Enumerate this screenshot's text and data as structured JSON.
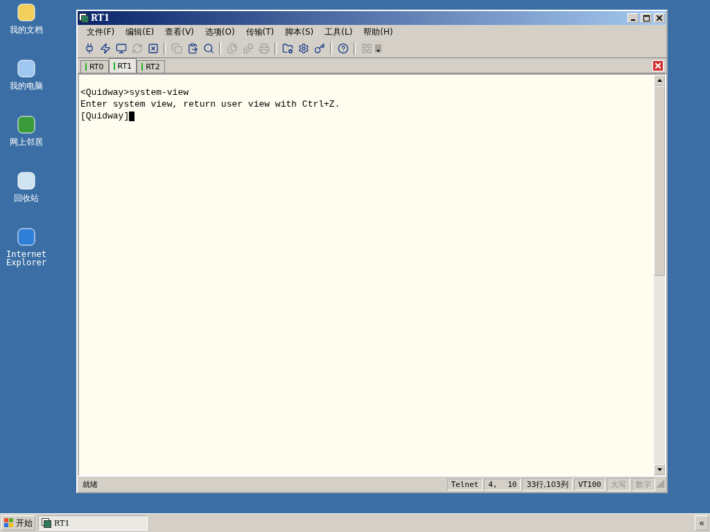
{
  "desktop_icons": [
    {
      "label": "我的文档"
    },
    {
      "label": "我的电脑"
    },
    {
      "label": "网上邻居"
    },
    {
      "label": "回收站"
    },
    {
      "label": "Internet Explorer"
    }
  ],
  "window": {
    "title": "RT1"
  },
  "menu": [
    {
      "label": "文件(F)"
    },
    {
      "label": "编辑(E)"
    },
    {
      "label": "查看(V)"
    },
    {
      "label": "选项(O)"
    },
    {
      "label": "传输(T)"
    },
    {
      "label": "脚本(S)"
    },
    {
      "label": "工具(L)"
    },
    {
      "label": "帮助(H)"
    }
  ],
  "toolbar": [
    [
      {
        "disabled": false
      },
      {
        "disabled": false
      },
      {
        "disabled": false
      },
      {
        "disabled": true
      },
      {
        "disabled": false
      }
    ],
    [
      {
        "disabled": true
      },
      {
        "disabled": false
      },
      {
        "disabled": false
      }
    ],
    [
      {
        "disabled": true
      },
      {
        "disabled": true
      },
      {
        "disabled": true
      }
    ],
    [
      {
        "disabled": false
      },
      {
        "disabled": false
      },
      {
        "disabled": false
      }
    ],
    [
      {
        "disabled": false
      }
    ],
    [
      {
        "disabled": true
      }
    ]
  ],
  "tabs": [
    {
      "label": "RT0",
      "selected": false,
      "connected": true
    },
    {
      "label": "RT1",
      "selected": true,
      "connected": true
    },
    {
      "label": "RT2",
      "selected": false,
      "connected": true
    }
  ],
  "terminal": {
    "lines": [
      "<Quidway>system-view",
      "Enter system view, return user view with Ctrl+Z.",
      "[Quidway]"
    ],
    "cursor": true
  },
  "status_bar": {
    "message": "就绪",
    "protocol": "Telnet",
    "row": "4,",
    "column": "10",
    "size": "33行,103列",
    "emulation": "VT100",
    "caps": {
      "label": "大写",
      "on": false
    },
    "num": {
      "label": "数字",
      "on": false
    }
  },
  "taskbar": {
    "start": "开始",
    "tasks": [
      {
        "label": "RT1",
        "selected": true
      }
    ],
    "expand": "«"
  }
}
